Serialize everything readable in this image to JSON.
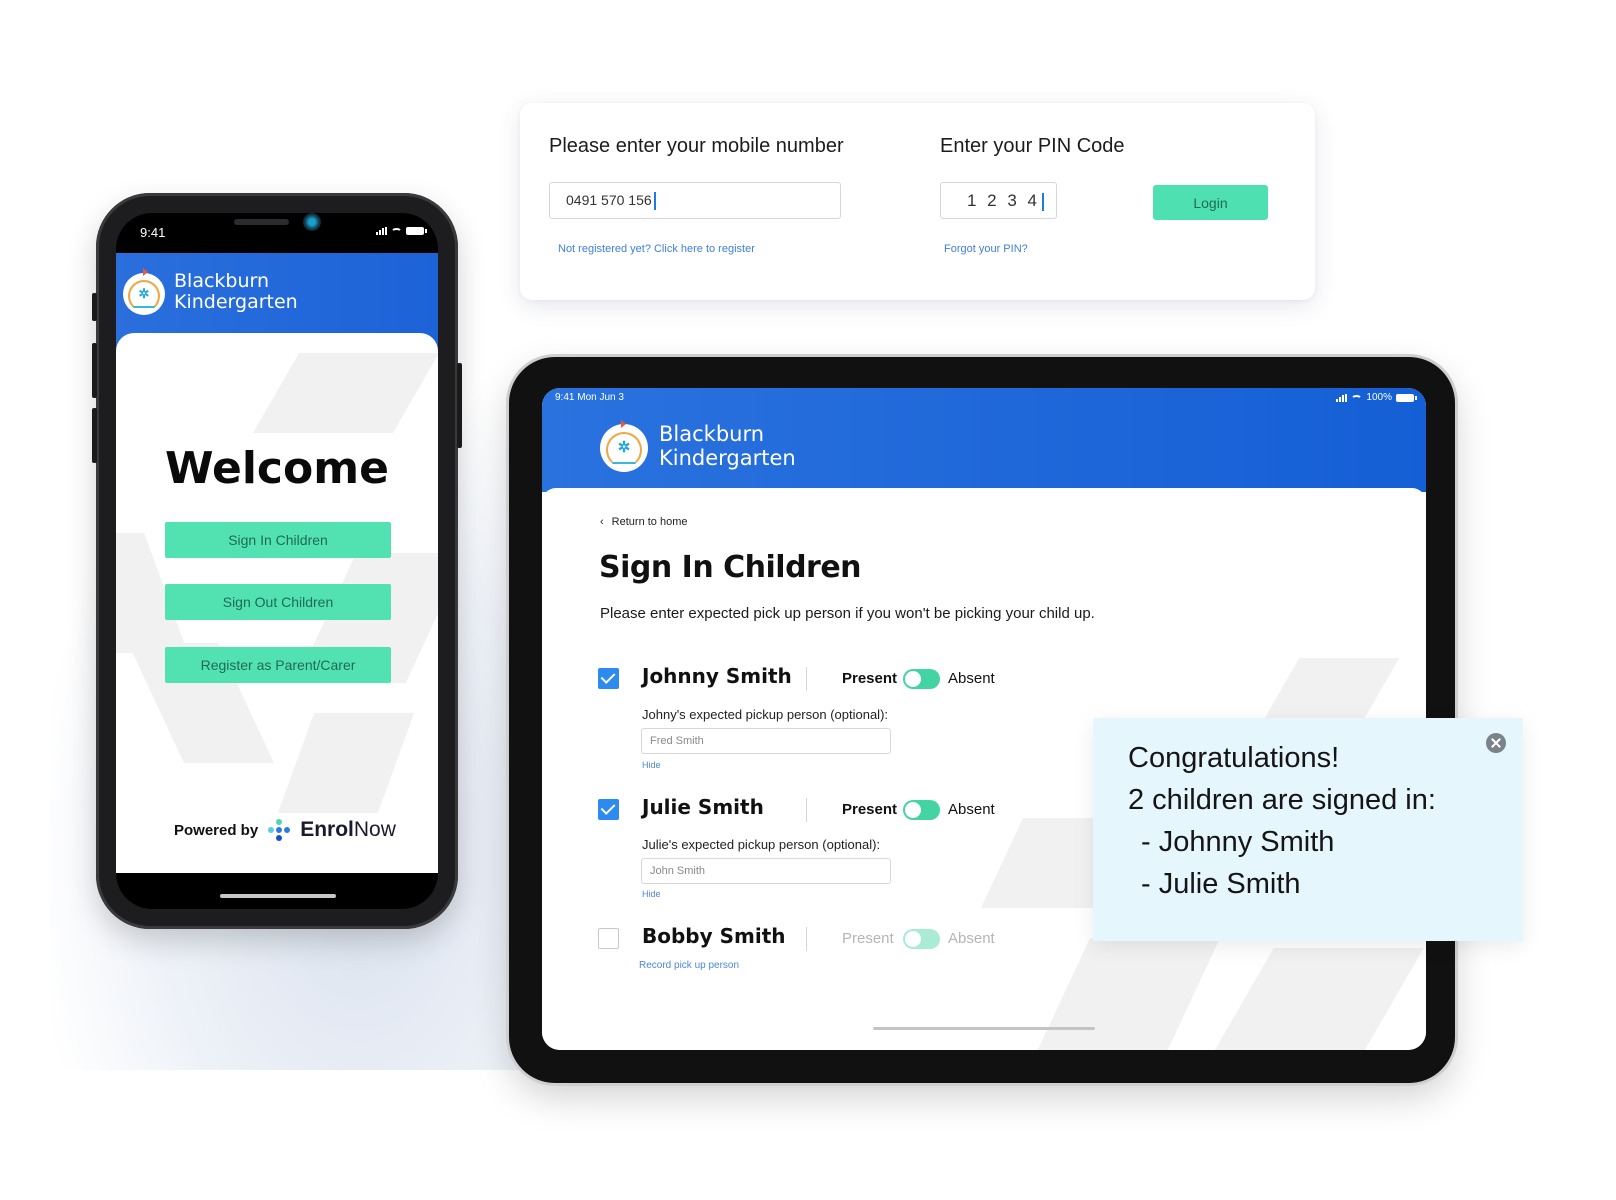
{
  "login_card": {
    "mobile_label": "Please enter your mobile number",
    "mobile_value": "0491 570 156",
    "register_link": "Not registered yet? Click here to register",
    "pin_label": "Enter your PIN Code",
    "pin_value": "1 2 3 4",
    "forgot_link": "Forgot your PIN?",
    "login_button": "Login"
  },
  "phone": {
    "status_time": "9:41",
    "brand_line1": "Blackburn",
    "brand_line2": "Kindergarten",
    "welcome": "Welcome",
    "buttons": [
      "Sign In Children",
      "Sign Out Children",
      "Register as Parent/Carer"
    ],
    "powered_by": "Powered by",
    "enrol_bold": "Enrol",
    "enrol_light": "Now"
  },
  "tablet": {
    "status_time": "9:41  Mon Jun 3",
    "status_battery": "100%",
    "brand_line1": "Blackburn",
    "brand_line2": "Kindergarten",
    "back_link": "Return to home",
    "title": "Sign In Children",
    "subtitle": "Please enter expected pick up person if you won't be picking your child up.",
    "present_label": "Present",
    "absent_label": "Absent",
    "hide_label": "Hide",
    "children": [
      {
        "name": "Johnny Smith",
        "checked": true,
        "pickup_label": "Johny's expected pickup person (optional):",
        "pickup_value": "Fred Smith"
      },
      {
        "name": "Julie Smith",
        "checked": true,
        "pickup_label": "Julie's expected pickup person (optional):",
        "pickup_value": "John Smith"
      },
      {
        "name": "Bobby Smith",
        "checked": false,
        "record_link": "Record pick up person"
      }
    ]
  },
  "toast": {
    "line1": "Congratulations!",
    "line2": "2 children are signed in:",
    "line3": "  - Johnny Smith",
    "line4": "  - Julie Smith"
  },
  "colors": {
    "brand_blue": "#1d63d8",
    "accent_green": "#52e2b2",
    "link_blue": "#3f7fe0",
    "checkbox_blue": "#2d8bf0",
    "toast_bg": "#e6f6fd"
  }
}
